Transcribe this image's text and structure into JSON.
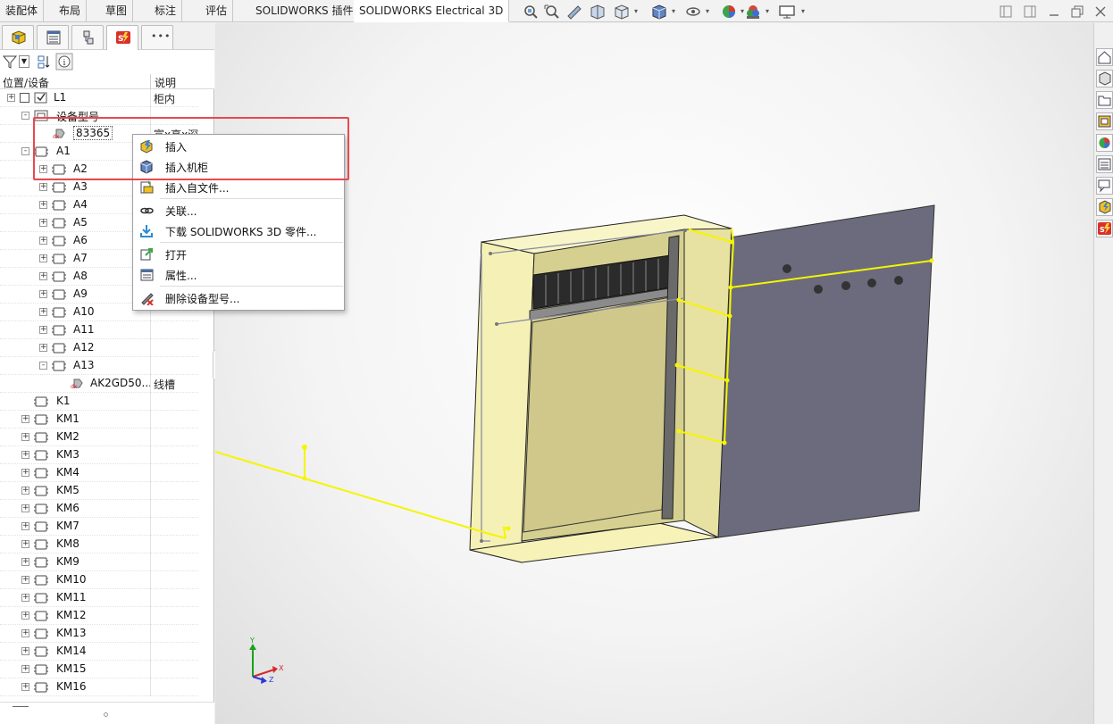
{
  "tabs": [
    "装配体",
    "布局",
    "草图",
    "标注",
    "评估",
    "SOLIDWORKS 插件",
    "SOLIDWORKS Electrical 3D"
  ],
  "active_tab": "SOLIDWORKS Electrical 3D",
  "toolbar_icons": [
    "zoom-to-fit-icon",
    "zoom-area-icon",
    "previous-view-icon",
    "section-view-icon",
    "view-orientation-icon",
    "display-style-icon",
    "hide-show-icon",
    "edit-appearance-icon",
    "apply-scene-icon",
    "view-settings-icon"
  ],
  "window_controls": [
    "restore-left-icon",
    "restore-right-icon",
    "tile-icon",
    "maximize-icon",
    "close-icon"
  ],
  "panel": {
    "tabs": [
      "feature-manager-icon",
      "property-manager-icon",
      "configuration-manager-icon",
      "electrical-manager-icon",
      "more-icon"
    ],
    "more_label": "•••",
    "col_location": "位置/设备",
    "col_desc": "说明"
  },
  "tree": [
    {
      "label": "L1",
      "desc": "柜内",
      "level": 0,
      "expander": "+",
      "icon": "location"
    },
    {
      "label": "设备型号",
      "desc": "",
      "level": 1,
      "expander": "-",
      "icon": "model"
    },
    {
      "label": "83365",
      "desc": "富x高x深",
      "level": 2,
      "expander": "",
      "icon": "part"
    },
    {
      "label": "A1",
      "desc": "",
      "level": 1,
      "expander": "-",
      "icon": "device"
    },
    {
      "label": "A2",
      "desc": "",
      "level": 2,
      "expander": "+",
      "icon": "device"
    },
    {
      "label": "A3",
      "desc": "",
      "level": 2,
      "expander": "+",
      "icon": "device"
    },
    {
      "label": "A4",
      "desc": "",
      "level": 2,
      "expander": "+",
      "icon": "device"
    },
    {
      "label": "A5",
      "desc": "",
      "level": 2,
      "expander": "+",
      "icon": "device"
    },
    {
      "label": "A6",
      "desc": "",
      "level": 2,
      "expander": "+",
      "icon": "device"
    },
    {
      "label": "A7",
      "desc": "",
      "level": 2,
      "expander": "+",
      "icon": "device"
    },
    {
      "label": "A8",
      "desc": "",
      "level": 2,
      "expander": "+",
      "icon": "device"
    },
    {
      "label": "A9",
      "desc": "",
      "level": 2,
      "expander": "+",
      "icon": "device"
    },
    {
      "label": "A10",
      "desc": "",
      "level": 2,
      "expander": "+",
      "icon": "device"
    },
    {
      "label": "A11",
      "desc": "",
      "level": 2,
      "expander": "+",
      "icon": "device"
    },
    {
      "label": "A12",
      "desc": "",
      "level": 2,
      "expander": "+",
      "icon": "device"
    },
    {
      "label": "A13",
      "desc": "",
      "level": 2,
      "expander": "-",
      "icon": "device"
    },
    {
      "label": "AK2GD50...",
      "desc": "线槽",
      "level": 3,
      "expander": "",
      "icon": "part"
    },
    {
      "label": "K1",
      "desc": "",
      "level": 1,
      "expander": "",
      "icon": "device"
    },
    {
      "label": "KM1",
      "desc": "",
      "level": 1,
      "expander": "+",
      "icon": "device"
    },
    {
      "label": "KM2",
      "desc": "",
      "level": 1,
      "expander": "+",
      "icon": "device"
    },
    {
      "label": "KM3",
      "desc": "",
      "level": 1,
      "expander": "+",
      "icon": "device"
    },
    {
      "label": "KM4",
      "desc": "",
      "level": 1,
      "expander": "+",
      "icon": "device"
    },
    {
      "label": "KM5",
      "desc": "",
      "level": 1,
      "expander": "+",
      "icon": "device"
    },
    {
      "label": "KM6",
      "desc": "",
      "level": 1,
      "expander": "+",
      "icon": "device"
    },
    {
      "label": "KM7",
      "desc": "",
      "level": 1,
      "expander": "+",
      "icon": "device"
    },
    {
      "label": "KM8",
      "desc": "",
      "level": 1,
      "expander": "+",
      "icon": "device"
    },
    {
      "label": "KM9",
      "desc": "",
      "level": 1,
      "expander": "+",
      "icon": "device"
    },
    {
      "label": "KM10",
      "desc": "",
      "level": 1,
      "expander": "+",
      "icon": "device"
    },
    {
      "label": "KM11",
      "desc": "",
      "level": 1,
      "expander": "+",
      "icon": "device"
    },
    {
      "label": "KM12",
      "desc": "",
      "level": 1,
      "expander": "+",
      "icon": "device"
    },
    {
      "label": "KM13",
      "desc": "",
      "level": 1,
      "expander": "+",
      "icon": "device"
    },
    {
      "label": "KM14",
      "desc": "",
      "level": 1,
      "expander": "+",
      "icon": "device"
    },
    {
      "label": "KM15",
      "desc": "",
      "level": 1,
      "expander": "+",
      "icon": "device"
    },
    {
      "label": "KM16",
      "desc": "",
      "level": 1,
      "expander": "+",
      "icon": "device"
    }
  ],
  "context_menu": [
    {
      "label": "插入",
      "icon": "insert-icon"
    },
    {
      "label": "插入机柜",
      "icon": "insert-cabinet-icon"
    },
    {
      "label": "插入自文件...",
      "icon": "insert-from-file-icon"
    },
    {
      "separator": true
    },
    {
      "label": "关联...",
      "icon": "associate-icon"
    },
    {
      "label": "下载 SOLIDWORKS 3D 零件...",
      "icon": "download-icon"
    },
    {
      "separator": true
    },
    {
      "label": "打开",
      "icon": "open-icon"
    },
    {
      "label": "属性...",
      "icon": "properties-icon"
    },
    {
      "separator": true
    },
    {
      "label": "删除设备型号...",
      "icon": "delete-model-icon"
    }
  ],
  "highlight_color": "#e8494f",
  "wire_color": "#f5f500",
  "cabinet_color": "#f7f3b8",
  "door_color": "#6b6b7d",
  "triad_labels": [
    "Y",
    "X",
    "Z"
  ],
  "right_bar_icons": [
    "home-icon",
    "parts-icon",
    "folder-icon",
    "view-palette-icon",
    "appearances-icon",
    "custom-properties-icon",
    "forum-icon",
    "electrical-3d-icon",
    "solidworks-electrical-icon"
  ]
}
